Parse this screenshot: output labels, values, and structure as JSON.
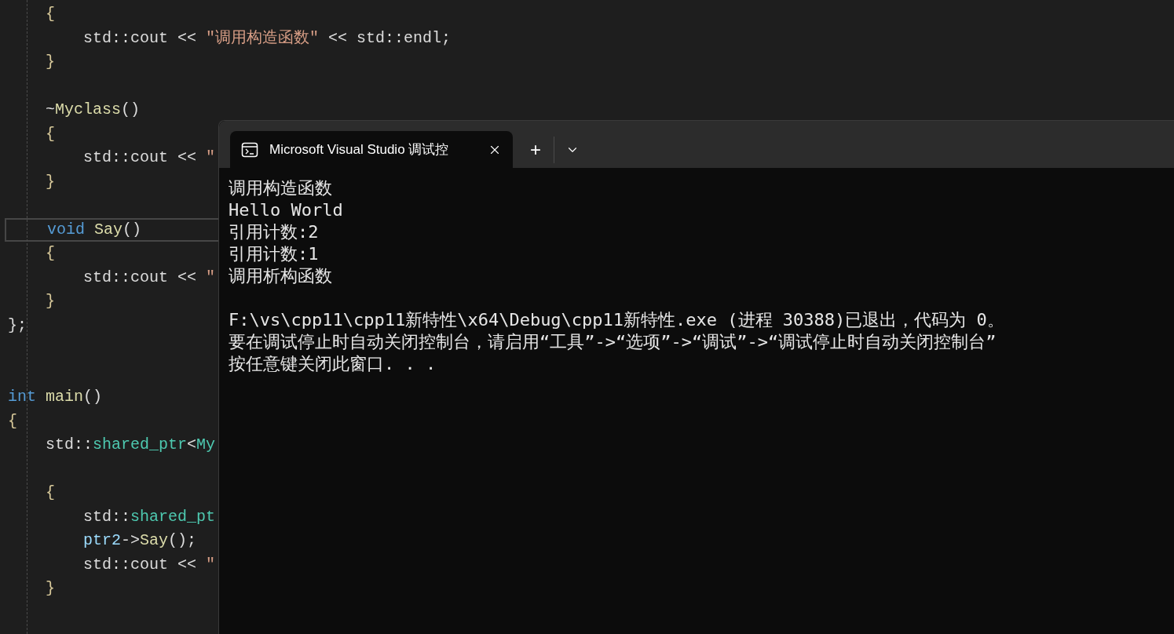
{
  "editor": {
    "lines": [
      {
        "current": false,
        "tokens": [
          {
            "kind": "brace",
            "text": "    {"
          }
        ]
      },
      {
        "current": false,
        "tokens": [
          {
            "kind": "plain",
            "text": "        std::cout << "
          },
          {
            "kind": "string",
            "text": "\"调用构造函数\""
          },
          {
            "kind": "plain",
            "text": " << std::endl;"
          }
        ]
      },
      {
        "current": false,
        "tokens": [
          {
            "kind": "brace",
            "text": "    }"
          }
        ]
      },
      {
        "current": false
      },
      {
        "current": false,
        "tokens": [
          {
            "kind": "plain",
            "text": "    ~"
          },
          {
            "kind": "function",
            "text": "Myclass"
          },
          {
            "kind": "plain",
            "text": "()"
          }
        ]
      },
      {
        "current": false,
        "tokens": [
          {
            "kind": "brace",
            "text": "    {"
          }
        ]
      },
      {
        "current": false,
        "tokens": [
          {
            "kind": "plain",
            "text": "        std::cout << "
          },
          {
            "kind": "string",
            "text": "\""
          }
        ]
      },
      {
        "current": false,
        "tokens": [
          {
            "kind": "brace",
            "text": "    }"
          }
        ]
      },
      {
        "current": false
      },
      {
        "current": true,
        "tokens": [
          {
            "kind": "keyword",
            "text": "    void"
          },
          {
            "kind": "function",
            "text": " Say"
          },
          {
            "kind": "plain",
            "text": "()"
          }
        ]
      },
      {
        "current": false,
        "tokens": [
          {
            "kind": "brace",
            "text": "    {"
          }
        ]
      },
      {
        "current": false,
        "tokens": [
          {
            "kind": "plain",
            "text": "        std::cout << "
          },
          {
            "kind": "string",
            "text": "\""
          }
        ]
      },
      {
        "current": false,
        "tokens": [
          {
            "kind": "brace",
            "text": "    }"
          }
        ]
      },
      {
        "current": false,
        "tokens": [
          {
            "kind": "plain",
            "text": "};"
          }
        ]
      },
      {
        "current": false
      },
      {
        "current": false
      },
      {
        "current": false,
        "tokens": [
          {
            "kind": "keyword",
            "text": "int"
          },
          {
            "kind": "function",
            "text": " main"
          },
          {
            "kind": "plain",
            "text": "()"
          }
        ]
      },
      {
        "current": false,
        "tokens": [
          {
            "kind": "brace",
            "text": "{"
          }
        ]
      },
      {
        "current": false,
        "tokens": [
          {
            "kind": "plain",
            "text": "    std::"
          },
          {
            "kind": "type",
            "text": "shared_ptr"
          },
          {
            "kind": "plain",
            "text": "<"
          },
          {
            "kind": "type",
            "text": "My"
          }
        ]
      },
      {
        "current": false
      },
      {
        "current": false,
        "tokens": [
          {
            "kind": "brace",
            "text": "    {"
          }
        ]
      },
      {
        "current": false,
        "tokens": [
          {
            "kind": "plain",
            "text": "        std::"
          },
          {
            "kind": "type",
            "text": "shared_pt"
          }
        ]
      },
      {
        "current": false,
        "tokens": [
          {
            "kind": "variable",
            "text": "        ptr2"
          },
          {
            "kind": "plain",
            "text": "->"
          },
          {
            "kind": "function",
            "text": "Say"
          },
          {
            "kind": "plain",
            "text": "();"
          }
        ]
      },
      {
        "current": false,
        "tokens": [
          {
            "kind": "plain",
            "text": "        std::cout << "
          },
          {
            "kind": "string",
            "text": "\""
          }
        ]
      },
      {
        "current": false,
        "tokens": [
          {
            "kind": "brace",
            "text": "    }"
          }
        ]
      }
    ]
  },
  "console": {
    "tab": {
      "title": "Microsoft Visual Studio 调试控",
      "selected": true
    },
    "new_tab": "+",
    "output": [
      "调用构造函数",
      "Hello World",
      "引用计数:2",
      "引用计数:1",
      "调用析构函数"
    ],
    "messages": [
      "F:\\vs\\cpp11\\cpp11新特性\\x64\\Debug\\cpp11新特性.exe (进程 30388)已退出，代码为 0。",
      "要在调试停止时自动关闭控制台，请启用“工具”->“选项”->“调试”->“调试停止时自动关闭控制台”",
      "按任意键关闭此窗口. . ."
    ]
  }
}
